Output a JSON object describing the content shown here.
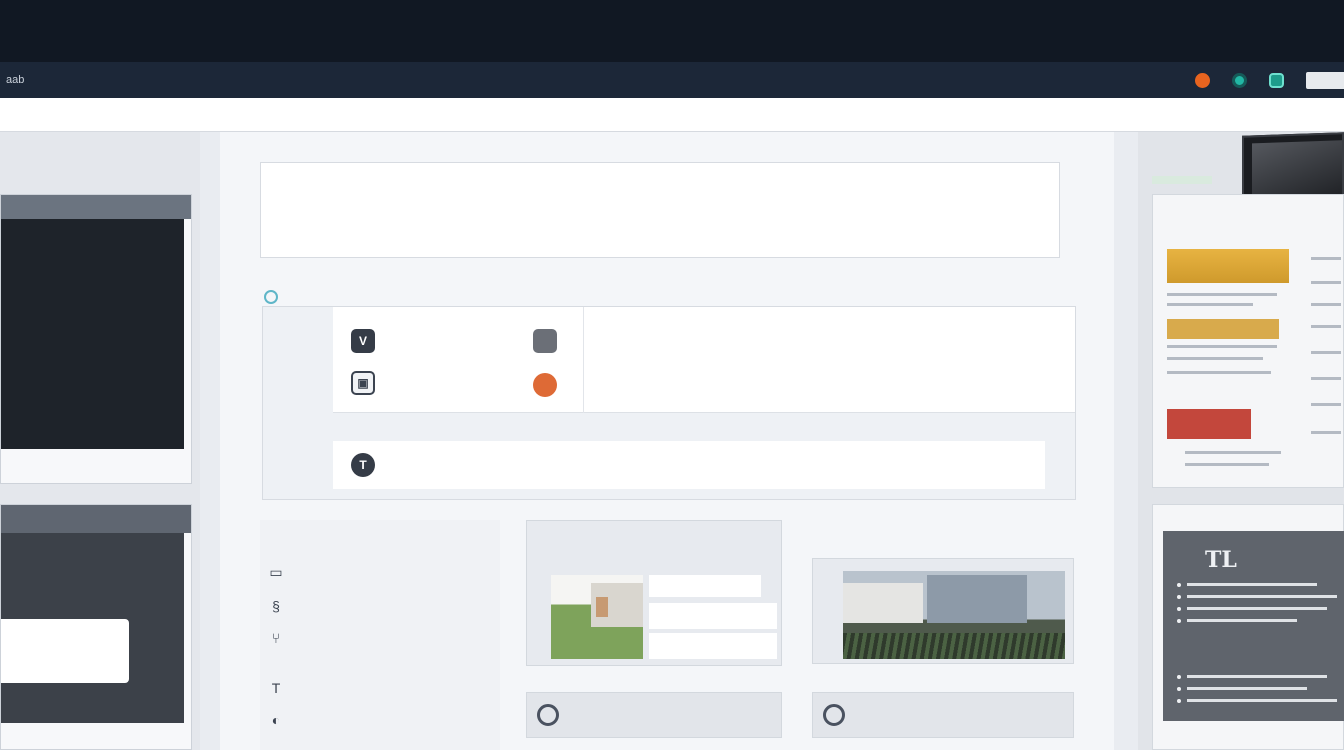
{
  "window": {
    "title": "aab"
  },
  "toolbar": {
    "icons": [
      "record-icon",
      "globe-icon",
      "chip-icon"
    ],
    "accent": "#e8641f"
  },
  "left": {
    "header": "",
    "terminal": {
      "title": "",
      "lines": [
        "",
        "",
        "",
        "",
        "",
        "",
        "",
        "",
        "",
        "",
        ""
      ]
    },
    "panel": {
      "title": "",
      "line1": "",
      "line2": "",
      "footer": ""
    }
  },
  "main": {
    "header": "",
    "header_mid": "",
    "header_right": "",
    "info": [
      {
        "label": "",
        "lines": [
          "",
          ""
        ]
      },
      {
        "label": "",
        "lines": [
          "",
          ""
        ]
      },
      {
        "label": "",
        "lines": [
          "",
          ""
        ]
      }
    ],
    "features_header": "",
    "features": [
      {
        "icon": "v-icon",
        "name": "",
        "desc": "",
        "desc2": ""
      },
      {
        "icon": "image-icon",
        "name": "",
        "name2": "",
        "desc": ""
      },
      {
        "icon": "t-icon",
        "name": "",
        "desc": ""
      }
    ],
    "lower_header": "",
    "list": [
      {
        "icon": "card-icon",
        "name": "",
        "value": ""
      },
      {
        "icon": "s-icon",
        "name": "",
        "value": ""
      },
      {
        "icon": "fork-icon",
        "name": "",
        "value": ""
      },
      {
        "icon": "t-icon",
        "name": "",
        "value": ""
      },
      {
        "icon": "comment-icon",
        "name": "",
        "value": ""
      }
    ],
    "card1_caption": "",
    "card2_caption": "",
    "mini1": "",
    "mini2": ""
  },
  "right": {
    "header": "",
    "doc_title": "",
    "doc_side": "",
    "highlights": [
      "",
      "",
      ""
    ],
    "dark_title": "",
    "dark_big": "TL"
  }
}
